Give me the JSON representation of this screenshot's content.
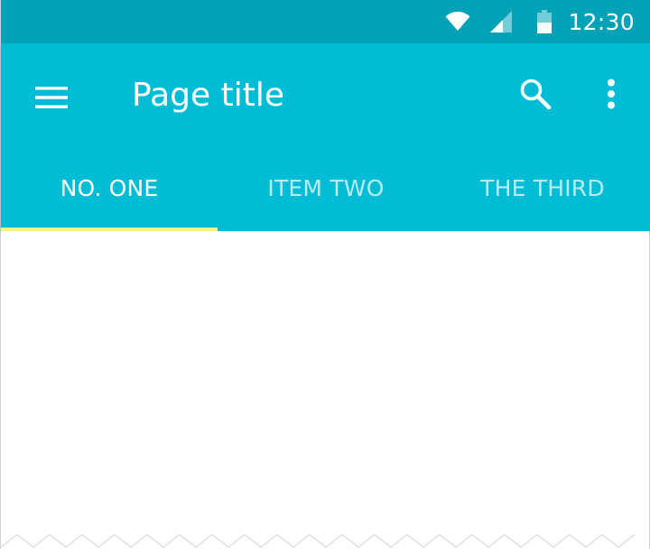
{
  "status_bar": {
    "time": "12:30",
    "color": "#00a2b8",
    "icons": [
      "wifi-icon",
      "cell-signal-icon",
      "battery-icon"
    ]
  },
  "app_bar": {
    "title": "Page title",
    "color": "#00bcd4",
    "icons": [
      "menu-icon",
      "search-icon",
      "more-vert-icon"
    ]
  },
  "tabs": [
    {
      "label": "NO. ONE",
      "active": true
    },
    {
      "label": "ITEM TWO",
      "active": false
    },
    {
      "label": "THE THIRD",
      "active": false
    }
  ],
  "tab_indicator_color": "#f0f58a"
}
